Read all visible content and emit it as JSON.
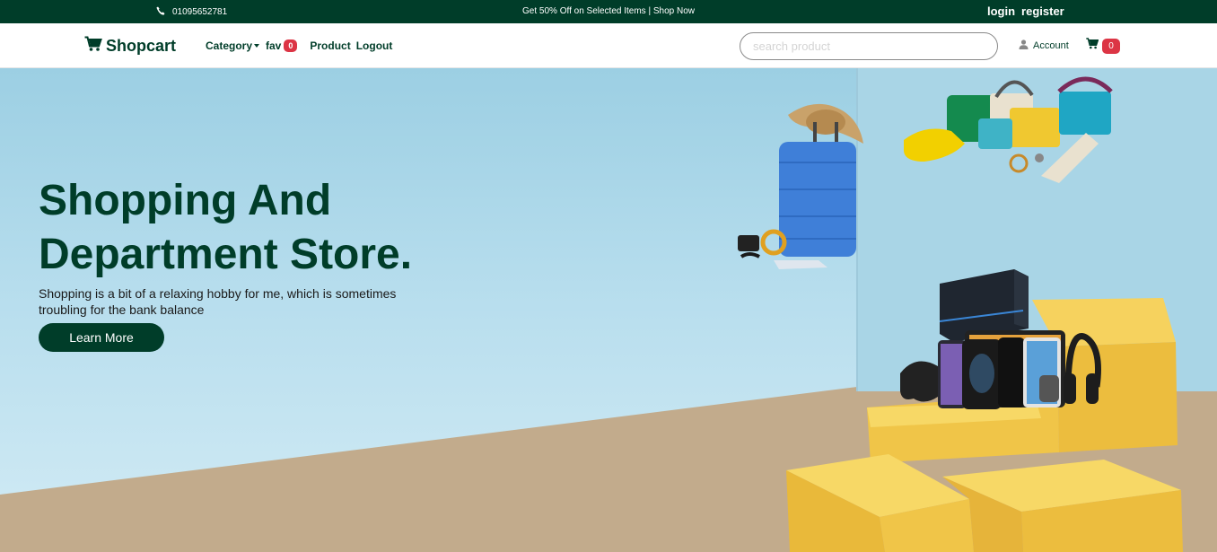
{
  "topbar": {
    "phone": "01095652781",
    "promo": "Get 50% Off on Selected Items | Shop Now",
    "login": "login",
    "register": "register"
  },
  "navbar": {
    "brand": "Shopcart",
    "category": "Category",
    "fav": "fav",
    "fav_count": "0",
    "product": "Product",
    "logout": "Logout",
    "search_placeholder": "search product",
    "account": "Account",
    "cart_count": "0"
  },
  "hero": {
    "title": "Shopping And Department Store.",
    "subtitle": "Shopping is a bit of a relaxing hobby for me, which is sometimes troubling for the bank balance",
    "cta": "Learn More"
  },
  "colors": {
    "brand": "#003d29",
    "badge": "#dc3545",
    "sky": "#a8d6e9",
    "floor": "#c2ab8c",
    "boxes": "#f1c247"
  },
  "icons": [
    "phone-icon",
    "cart-logo-icon",
    "chevron-down-icon",
    "user-icon",
    "cart-icon"
  ]
}
